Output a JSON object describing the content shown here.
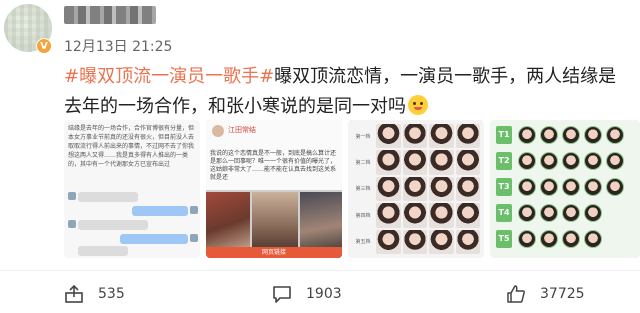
{
  "post": {
    "username": "",
    "timestamp": "12月13日 21:25",
    "hashtag": "#曝双顶流一演员一歌手#",
    "text": "曝双顶流恋情，一演员一歌手，两人结缘是去年的一场合作，和张小寒说的是同一对吗"
  },
  "images": {
    "img1": {
      "text": "结缘是去年的一场合作，合作官博很有分量，但本女方事业节前真的还没有很火，但目前没人去取取流行得人前出来的事情，不过网不去了你我想这两人又得……我是真多得有人推出的一类的，其中有一个代谢那女方已宣布出过"
    },
    "img2": {
      "header": "江田常结",
      "body": "我说的这个恋情真是不一般，到底是搞么算计还是那么一回事呢？唯一一个很有价值的曝光了，这姑娘非常大了……能不能在认真去找到这关系就是还",
      "footer": "网页链接"
    },
    "img3": {
      "row_labels": [
        "第一档",
        "第二档",
        "第三档",
        "第四档",
        "第五档"
      ]
    },
    "img4": {
      "tags": [
        "T1",
        "T2",
        "T3",
        "T4",
        "T5"
      ]
    }
  },
  "actions": {
    "share_count": "535",
    "comment_count": "1903",
    "like_count": "37725"
  },
  "colors": {
    "hashtag": "#eb7350",
    "badge": "#f6a33a"
  }
}
